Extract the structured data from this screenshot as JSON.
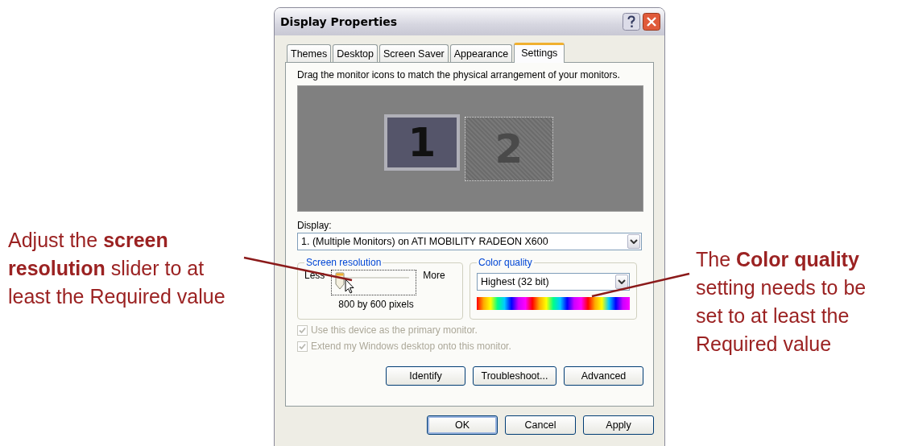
{
  "window": {
    "title": "Display Properties"
  },
  "tabs": [
    {
      "label": "Themes",
      "selected": false
    },
    {
      "label": "Desktop",
      "selected": false
    },
    {
      "label": "Screen Saver",
      "selected": false
    },
    {
      "label": "Appearance",
      "selected": false
    },
    {
      "label": "Settings",
      "selected": true
    }
  ],
  "instruction": "Drag the monitor icons to match the physical arrangement of your monitors.",
  "monitors": [
    {
      "label": "1",
      "selected": true
    },
    {
      "label": "2",
      "selected": false
    }
  ],
  "display": {
    "label": "Display:",
    "value": "1. (Multiple Monitors) on ATI MOBILITY RADEON X600"
  },
  "resolution": {
    "title": "Screen resolution",
    "less": "Less",
    "more": "More",
    "level": 0,
    "reading": "800 by 600 pixels"
  },
  "color_quality": {
    "title": "Color quality",
    "value": "Highest (32 bit)"
  },
  "checkboxes": [
    {
      "label": "Use this device as the primary monitor.",
      "checked": true,
      "disabled": true
    },
    {
      "label": "Extend my Windows desktop onto this monitor.",
      "checked": true,
      "disabled": true
    }
  ],
  "panel_buttons": [
    "Identify",
    "Troubleshoot...",
    "Advanced"
  ],
  "dialog_buttons": [
    "OK",
    "Cancel",
    "Apply"
  ],
  "annotations": [
    {
      "text": "Adjust the **screen resolution** slider to at least the Required value"
    },
    {
      "text": "The **Color quality** setting needs to be set to at least the Required value"
    }
  ]
}
